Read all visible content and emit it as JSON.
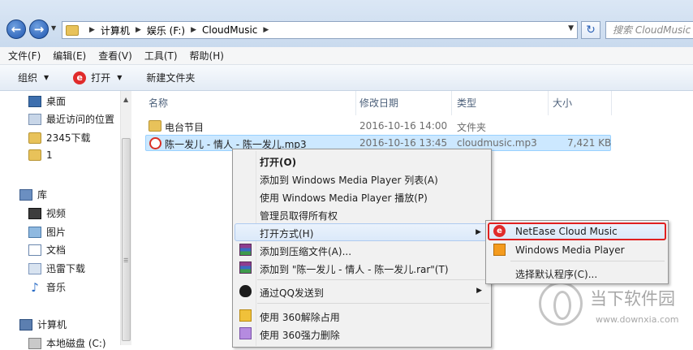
{
  "address": {
    "crumbs": [
      "计算机",
      "娱乐 (F:)",
      "CloudMusic"
    ],
    "search_placeholder": "搜索 CloudMusic"
  },
  "menubar": [
    "文件(F)",
    "编辑(E)",
    "查看(V)",
    "工具(T)",
    "帮助(H)"
  ],
  "toolbar": {
    "organize": "组织",
    "open": "打开",
    "new_folder": "新建文件夹"
  },
  "nav": {
    "desktop": "桌面",
    "recent": "最近访问的位置",
    "d2345": "2345下载",
    "one": "1",
    "library": "库",
    "video": "视频",
    "pictures": "图片",
    "documents": "文档",
    "xunlei": "迅雷下载",
    "music": "音乐",
    "computer": "计算机",
    "local_disk": "本地磁盘 (C:)"
  },
  "columns": {
    "name": "名称",
    "date": "修改日期",
    "type": "类型",
    "size": "大小"
  },
  "files": [
    {
      "name": "电台节目",
      "date": "2016-10-16 14:00",
      "type": "文件夹",
      "size": ""
    },
    {
      "name": "陈一发儿 - 情人 - 陈一发儿.mp3",
      "date": "2016-10-16 13:45",
      "type": "cloudmusic.mp3",
      "size": "7,421 KB"
    }
  ],
  "context_menu": {
    "open": "打开(O)",
    "add_wmp_list": "添加到 Windows Media Player 列表(A)",
    "play_wmp": "使用 Windows Media Player 播放(P)",
    "take_ownership": "管理员取得所有权",
    "open_with": "打开方式(H)",
    "add_archive": "添加到压缩文件(A)...",
    "add_rar": "添加到 \"陈一发儿 - 情人 - 陈一发儿.rar\"(T)",
    "send_qq": "通过QQ发送到",
    "unlock_360": "使用 360解除占用",
    "force_delete_360": "使用 360强力删除"
  },
  "submenu": {
    "netease": "NetEase Cloud Music",
    "wmp": "Windows Media Player",
    "choose_default": "选择默认程序(C)..."
  },
  "watermark": {
    "text": "当下软件园",
    "url": "www.downxia.com"
  }
}
